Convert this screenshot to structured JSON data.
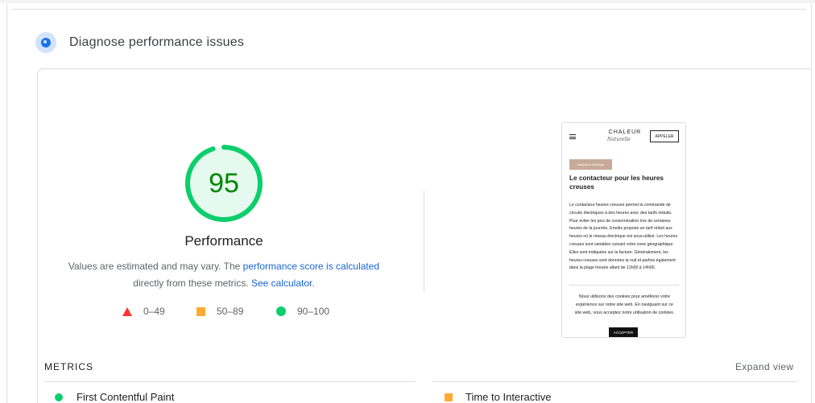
{
  "section": {
    "title": "Diagnose performance issues",
    "icon": "lighthouse-icon"
  },
  "gauge": {
    "score": "95",
    "score_value": 95,
    "title": "Performance",
    "color": "#0cce6b",
    "text_color": "#008800",
    "track_color": "#e6f9ef"
  },
  "description": {
    "prefix": "Values are estimated and may vary. The ",
    "link1": "performance score is calculated",
    "middle": " directly from these metrics. ",
    "link2": "See calculator",
    "suffix": "."
  },
  "legend": [
    {
      "range": "0–49",
      "shape": "triangle",
      "color": "#ff3333"
    },
    {
      "range": "50–89",
      "shape": "square",
      "color": "#ffaa33"
    },
    {
      "range": "90–100",
      "shape": "circle",
      "color": "#0cce6b"
    }
  ],
  "screenshot": {
    "logo": "CHALEUR",
    "logo_sub": "Naturelle",
    "call_button": "APPELER",
    "tag": "Installation électrique",
    "heading": "Le contacteur pour les heures creuses",
    "body": "Le contacteur heures creuses permet la commande de circuits électriques à des heures avec des tarifs réduits. Pour éviter les pics de consommation lors de certaines heures de la journée, Enedis propose un tarif réduit aux heures où le réseau électrique est sous-utilisé. Les heures creuses sont variables suivant votre zone géographique. Elles sont indiquées sur la facture. Généralement, les heures creuses sont données la nuit et parfois également dans la plage horaire allant de 12h00 à 14h00.",
    "cookie": "Nous utilisons des cookies pour améliorer votre expérience sur notre site web. En naviguant sur ce site web, vous acceptez notre utilisation de cookies.",
    "accept": "ACCEPTER"
  },
  "metrics": {
    "label": "METRICS",
    "expand": "Expand view",
    "left": "First Contentful Paint",
    "right": "Time to Interactive"
  }
}
